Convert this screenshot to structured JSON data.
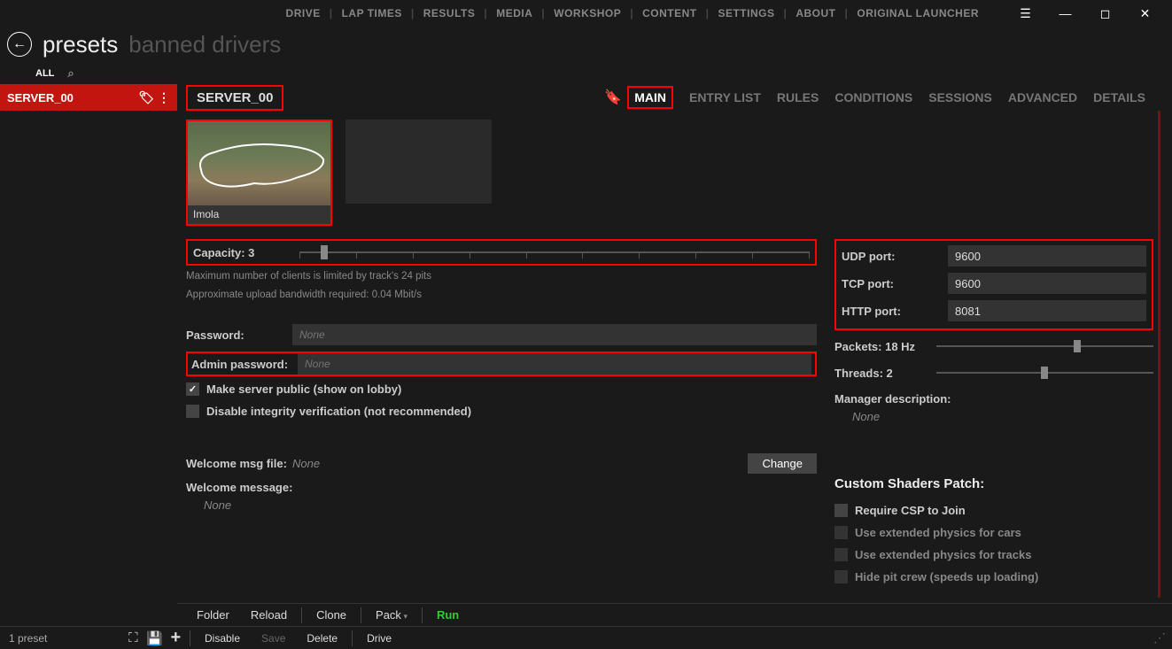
{
  "topmenu": [
    "DRIVE",
    "LAP TIMES",
    "RESULTS",
    "MEDIA",
    "WORKSHOP",
    "CONTENT",
    "SETTINGS",
    "ABOUT",
    "ORIGINAL LAUNCHER"
  ],
  "header": {
    "title": "presets",
    "subtitle": "banned drivers"
  },
  "filter": {
    "all": "ALL"
  },
  "sidebar": {
    "items": [
      {
        "name": "SERVER_00"
      }
    ]
  },
  "serverTab": {
    "label": "SERVER_00"
  },
  "tabs": [
    "MAIN",
    "ENTRY LIST",
    "RULES",
    "CONDITIONS",
    "SESSIONS",
    "ADVANCED",
    "DETAILS"
  ],
  "track": {
    "name": "Imola"
  },
  "capacity": {
    "label": "Capacity: 3",
    "hint1": "Maximum number of clients is limited by track's 24 pits",
    "hint2": "Approximate upload bandwidth required: 0.04 Mbit/s",
    "value": 3,
    "max": 24
  },
  "password": {
    "label": "Password:",
    "placeholder": "None"
  },
  "adminPassword": {
    "label": "Admin password:",
    "placeholder": "None"
  },
  "publicCheck": {
    "label": "Make server public (show on lobby)",
    "checked": true
  },
  "integrityCheck": {
    "label": "Disable integrity verification (not recommended)",
    "checked": false
  },
  "welcomeFile": {
    "label": "Welcome msg file:",
    "value": "None",
    "button": "Change"
  },
  "welcomeMessage": {
    "label": "Welcome message:",
    "value": "None"
  },
  "ports": {
    "udp": {
      "label": "UDP port:",
      "value": "9600"
    },
    "tcp": {
      "label": "TCP port:",
      "value": "9600"
    },
    "http": {
      "label": "HTTP port:",
      "value": "8081"
    }
  },
  "packets": {
    "label": "Packets: 18 Hz",
    "value": 18
  },
  "threads": {
    "label": "Threads: 2",
    "value": 2
  },
  "managerDesc": {
    "label": "Manager description:",
    "value": "None"
  },
  "csp": {
    "header": "Custom Shaders Patch:",
    "items": [
      "Require CSP to Join",
      "Use extended physics for cars",
      "Use extended physics for tracks",
      "Hide pit crew (speeds up loading)"
    ]
  },
  "bottom1": {
    "folder": "Folder",
    "reload": "Reload",
    "clone": "Clone",
    "pack": "Pack",
    "run": "Run"
  },
  "bottom2": {
    "count": "1 preset",
    "disable": "Disable",
    "save": "Save",
    "delete": "Delete",
    "drive": "Drive"
  }
}
